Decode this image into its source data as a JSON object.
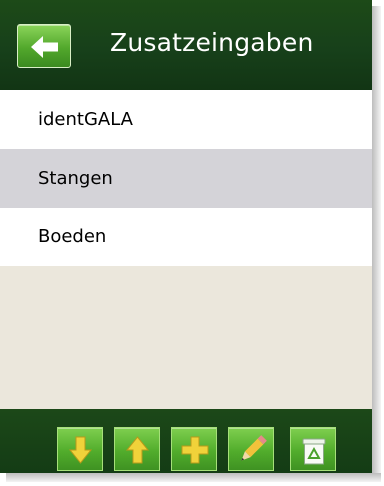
{
  "header": {
    "title": "Zusatzeingaben",
    "back_icon": "arrow-left-icon"
  },
  "list": {
    "items": [
      {
        "label": "identGALA",
        "selected": false
      },
      {
        "label": "Stangen",
        "selected": true
      },
      {
        "label": "Boeden",
        "selected": false
      }
    ]
  },
  "toolbar": {
    "buttons": [
      {
        "icon": "arrow-down-icon"
      },
      {
        "icon": "arrow-up-icon"
      },
      {
        "icon": "plus-icon"
      },
      {
        "icon": "pencil-icon"
      },
      {
        "icon": "recycle-bin-icon"
      }
    ]
  },
  "colors": {
    "header_bg": "#17401a",
    "button_green": "#52ad2c",
    "selected_row": "#d4d3d8",
    "empty_area": "#ebe7dc",
    "arrow_yellow": "#f0d23a"
  }
}
